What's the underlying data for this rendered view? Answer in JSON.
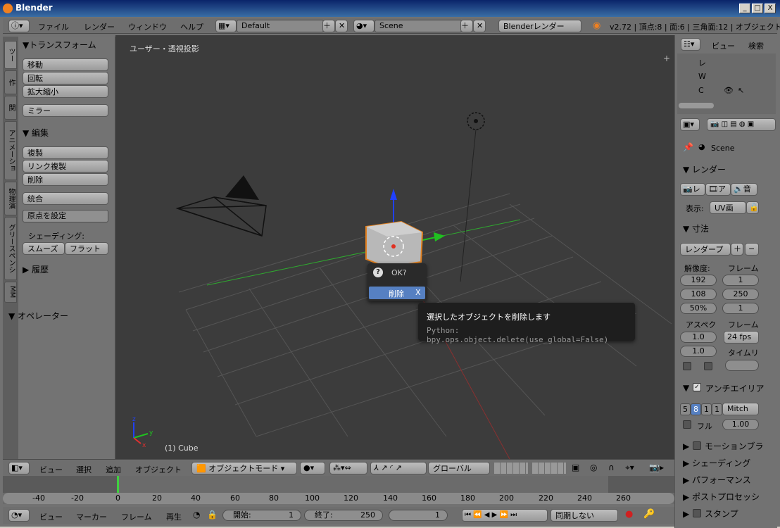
{
  "window": {
    "title": "Blender",
    "minimize": "_",
    "maximize": "□",
    "close": "X"
  },
  "topbar": {
    "menus": [
      "ファイル",
      "レンダー",
      "ウィンドウ",
      "ヘルプ"
    ],
    "layout": "Default",
    "scene": "Scene",
    "engine": "Blenderレンダー",
    "stats": "v2.72 | 頂点:8 | 面:6 | 三角面:12 | オブジェクト"
  },
  "left_tabs": [
    "ツー",
    "作",
    "関",
    "アニメーショ",
    "物理演",
    "グリースペンシ",
    "MM"
  ],
  "tools": {
    "transform_title": "▼トランスフォーム",
    "move": "移動",
    "rotate": "回転",
    "scale": "拡大縮小",
    "mirror": "ミラー",
    "edit_title": "▼ 編集",
    "duplicate": "複製",
    "duplicate_linked": "リンク複製",
    "delete": "削除",
    "join": "統合",
    "set_origin": "原点を設定",
    "shading_label": "シェーディング:",
    "smooth": "スムーズ",
    "flat": "フラット",
    "history": "▶ 履歴",
    "operator": "▼ オペレーター"
  },
  "viewport": {
    "label": "ユーザー・透視投影",
    "object": "(1) Cube",
    "popup": {
      "question": "OK?",
      "delete": "削除",
      "shortcut": "X"
    },
    "tooltip": {
      "title": "選択したオブジェクトを削除します",
      "python": "Python: bpy.ops.object.delete(use_global=False)"
    }
  },
  "outliner": {
    "view": "ビュー",
    "search": "検索",
    "rows": [
      "レ",
      "W",
      "C"
    ]
  },
  "properties": {
    "scene": "Scene",
    "render_title": "▼ レンダー",
    "render_btn": "レ",
    "anim_btn": "ア",
    "audio_btn": "音",
    "display_label": "表示:",
    "display_value": "UV画",
    "dimensions_title": "▼ 寸法",
    "preset": "レンダープ",
    "resolution_label": "解像度:",
    "frame_label": "フレーム",
    "res_x": "192",
    "res_y": "108",
    "res_pct": "50%",
    "frame_start": "1",
    "frame_end": "250",
    "frame_step": "1",
    "aspect_label": "アスペク",
    "frame_rate_label": "フレーム",
    "aspect_x": "1.0",
    "aspect_y": "1.0",
    "fps": "24 fps",
    "time_remap": "タイムリ",
    "aa_title": "アンチエイリア",
    "aa_samples": [
      "5",
      "8",
      "1",
      "1"
    ],
    "aa_filter": "Mitch",
    "full": "フル",
    "filter_size": "1.00",
    "motion_blur": "モーションブラ",
    "shading": "シェーディング",
    "performance": "パフォーマンス",
    "post": "ポストプロセッシ",
    "stamp": "スタンプ"
  },
  "header3d": {
    "view": "ビュー",
    "select": "選択",
    "add": "追加",
    "object": "オブジェクト",
    "mode": "オブジェクトモード",
    "orientation": "グローバル"
  },
  "timeline": {
    "ticks": [
      "-40",
      "-20",
      "0",
      "20",
      "40",
      "60",
      "80",
      "100",
      "120",
      "140",
      "160",
      "180",
      "200",
      "220",
      "240",
      "260"
    ]
  },
  "bottombar": {
    "view": "ビュー",
    "marker": "マーカー",
    "frame": "フレーム",
    "play": "再生",
    "start_label": "開始:",
    "start": "1",
    "end_label": "終了:",
    "end": "250",
    "current": "1",
    "sync": "同期しない"
  }
}
